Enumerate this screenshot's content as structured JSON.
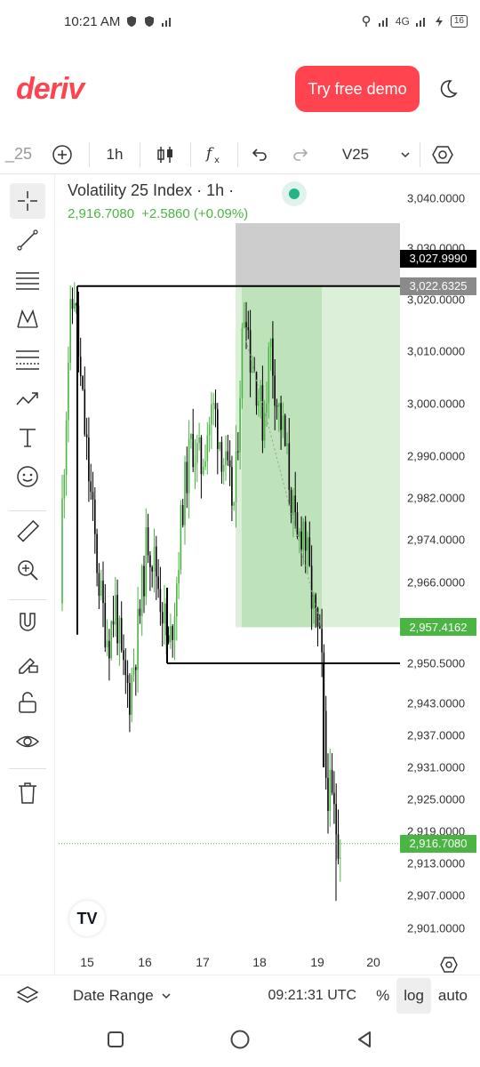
{
  "status_bar": {
    "time": "10:21 AM",
    "battery": "16",
    "network": "4G"
  },
  "header": {
    "logo": "deriv",
    "demo_button": "Try free demo",
    "theme_icon": "moon-icon"
  },
  "toolbar": {
    "symbol_fragment": "25",
    "timeframe": "1h",
    "symbol_select": "V25"
  },
  "chart": {
    "title": "Volatility 25 Index · 1h ·",
    "price": "2,916.7080",
    "change": "+2.5860 (+0.09%)",
    "y_labels": [
      "3,040.0000",
      "3,030.0000",
      "3,020.0000",
      "3,010.0000",
      "3,000.0000",
      "2,990.0000",
      "2,982.0000",
      "2,974.0000",
      "2,966.0000",
      "2,950.5000",
      "2,943.0000",
      "2,937.0000",
      "2,931.0000",
      "2,925.0000",
      "2,919.0000",
      "2,913.0000",
      "2,907.0000",
      "2,901.0000"
    ],
    "price_tags": {
      "stop": "3,027.9990",
      "entry": "3,022.6325",
      "target": "2,957.4162",
      "current": "2,916.7080"
    },
    "x_labels": [
      "15",
      "16",
      "17",
      "18",
      "19",
      "20"
    ]
  },
  "bottom_bar": {
    "date_range": "Date Range",
    "time": "09:21:31 UTC",
    "percent": "%",
    "log": "log",
    "auto": "auto"
  },
  "colors": {
    "brand": "#ff444f",
    "up": "#4bb543",
    "down": "#000000",
    "profit_zone": "#a5d8a0",
    "stop_zone": "#c8c8c8"
  }
}
